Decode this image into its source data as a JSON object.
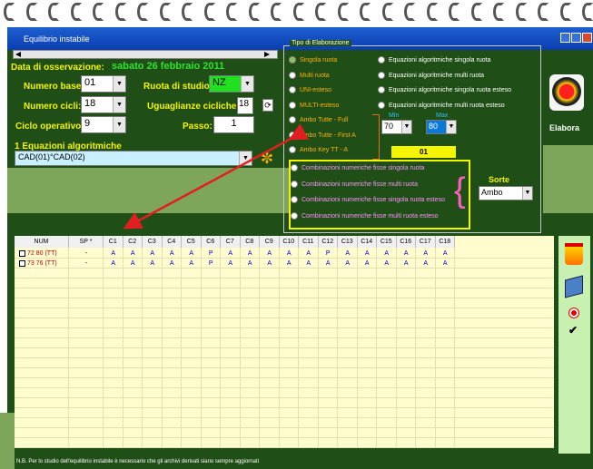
{
  "window": {
    "title": "Equilibrio instabile"
  },
  "form": {
    "data_label": "Data di osservazione:",
    "data_value": "sabato 26 febbraio 2011",
    "numero_base_label": "Numero base:",
    "numero_base_value": "01",
    "ruota_label": "Ruota di studio:",
    "ruota_value": "NZ",
    "numero_cicli_label": "Numero cicli:",
    "numero_cicli_value": "18",
    "uguaglianze_label": "Uguaglianze cicliche:",
    "uguaglianze_value": "18",
    "ciclo_label": "Ciclo operativo:",
    "ciclo_value": "9",
    "passo_label": "Passo:",
    "passo_value": "1",
    "equazioni_label": "1 Equazioni algoritmiche",
    "equazione_value": "CAD(01)°CAD(02)"
  },
  "tipo": {
    "title": "Tipo di Elaborazione",
    "left": [
      "Singola ruota",
      "Multi ruota",
      "UNI-esteso",
      "MULTI-esteso",
      "Ambo Tutte - Full",
      "Ambo Tutte - First A",
      "Ambo Key TT - A"
    ],
    "right": [
      "Equazioni algoritmiche singola ruota",
      "Equazioni algoritmiche multi ruota",
      "Equazioni algoritmiche singola ruota esteso",
      "Equazioni algoritmiche multi ruota esteso"
    ],
    "min_label": "Min",
    "max_label": "Max",
    "min_value": "70",
    "max_value": "80",
    "key_value": "01",
    "combinazioni": [
      "Combinazioni numeriche fisse singola ruota",
      "Combinazioni numeriche fisse multi ruota",
      "Combinazioni numeriche fisse singola ruota esteso",
      "Combinazioni numeriche fisse multi ruota esteso"
    ],
    "sorte_label": "Sorte",
    "sorte_value": "Ambo"
  },
  "elabora_label": "Elabora",
  "table": {
    "headers": [
      "NUM",
      "SP *",
      "C1",
      "C2",
      "C3",
      "C4",
      "C5",
      "C6",
      "C7",
      "C8",
      "C9",
      "C10",
      "C11",
      "C12",
      "C13",
      "C14",
      "C15",
      "C16",
      "C17",
      "C18"
    ],
    "rows": [
      {
        "num": "72 80  (TT)",
        "sp": "-",
        "cells": [
          "A",
          "A",
          "A",
          "A",
          "A",
          "P",
          "A",
          "A",
          "A",
          "A",
          "A",
          "P",
          "A",
          "A",
          "A",
          "A",
          "A",
          "A"
        ]
      },
      {
        "num": "73 76  (TT)",
        "sp": "-",
        "cells": [
          "A",
          "A",
          "A",
          "A",
          "A",
          "P",
          "A",
          "A",
          "A",
          "A",
          "A",
          "A",
          "A",
          "A",
          "A",
          "A",
          "A",
          "A"
        ]
      }
    ]
  },
  "footer_note": "N.B. Per lo studio dell'equilibrio instabile è necessario che gli archivi derivati siano sempre aggiornati",
  "colors": {
    "label_yellow": "#f5f500",
    "date_green": "#30e030",
    "window_green": "#1f4f16",
    "title_blue": "#0a3eb0",
    "grid_bg": "#fffdd0",
    "arrow_red": "#e02020"
  },
  "icons": [
    "eye-icon",
    "gear-icon",
    "refresh-icon",
    "trash-icon",
    "pen-icon",
    "no-entry-icon",
    "check-icon"
  ]
}
